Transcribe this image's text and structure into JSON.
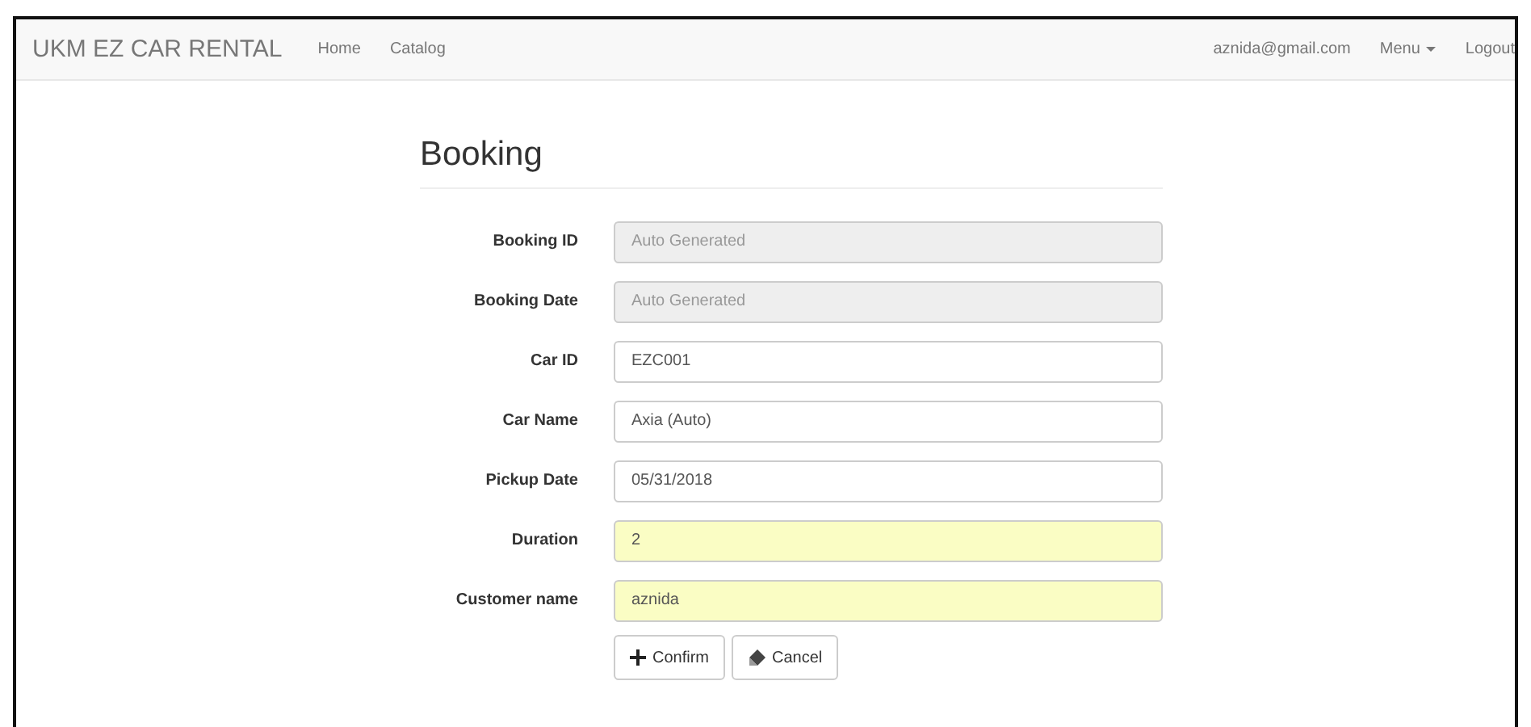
{
  "navbar": {
    "brand": "UKM EZ CAR RENTAL",
    "links": [
      "Home",
      "Catalog"
    ],
    "user": "aznida@gmail.com",
    "menu": "Menu",
    "logout": "Logout"
  },
  "title": "Booking",
  "fields": [
    {
      "label": "Booking ID",
      "kind": "disabled",
      "placeholder": "Auto Generated"
    },
    {
      "label": "Booking Date",
      "kind": "disabled",
      "placeholder": "Auto Generated"
    },
    {
      "label": "Car ID",
      "kind": "normal",
      "value": "EZC001"
    },
    {
      "label": "Car Name",
      "kind": "normal",
      "value": "Axia (Auto)"
    },
    {
      "label": "Pickup Date",
      "kind": "normal",
      "value": "05/31/2018"
    },
    {
      "label": "Duration",
      "kind": "autofill",
      "value": "2"
    },
    {
      "label": "Customer name",
      "kind": "autofill",
      "value": "aznida"
    }
  ],
  "buttons": [
    {
      "label": "Confirm",
      "kind": "confirm"
    },
    {
      "label": "Cancel",
      "kind": "cancel"
    }
  ]
}
